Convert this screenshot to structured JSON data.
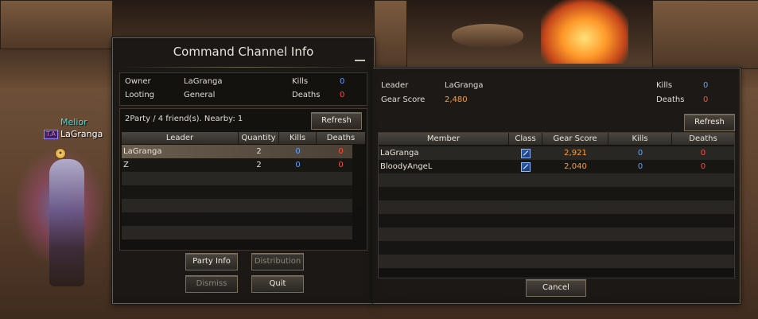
{
  "character": {
    "title": "Melior",
    "tag": "T.A",
    "name": "LaGranga"
  },
  "cc": {
    "title": "Command Channel Info",
    "owner_label": "Owner",
    "owner_value": "LaGranga",
    "looting_label": "Looting",
    "looting_value": "General",
    "kills_label": "Kills",
    "kills_value": "0",
    "deaths_label": "Deaths",
    "deaths_value": "0",
    "party_summary": "2Party / 4 friend(s). Nearby: 1",
    "refresh_label": "Refresh",
    "columns": [
      "Leader",
      "Quantity",
      "Kills",
      "Deaths"
    ],
    "rows": [
      {
        "leader": "LaGranga",
        "quantity": "2",
        "kills": "0",
        "deaths": "0"
      },
      {
        "leader": "Z",
        "quantity": "2",
        "kills": "0",
        "deaths": "0"
      }
    ],
    "buttons": {
      "party_info": "Party Info",
      "distribution": "Distribution",
      "dismiss": "Dismiss",
      "quit": "Quit"
    }
  },
  "party": {
    "leader_label": "Leader",
    "leader_value": "LaGranga",
    "gear_label": "Gear Score",
    "gear_value": "2,480",
    "kills_label": "Kills",
    "kills_value": "0",
    "deaths_label": "Deaths",
    "deaths_value": "0",
    "refresh_label": "Refresh",
    "columns": [
      "Member",
      "Class",
      "Gear Score",
      "Kills",
      "Deaths"
    ],
    "members": [
      {
        "member": "LaGranga",
        "class_icon": "blade-class-icon",
        "gear_score": "2,921",
        "kills": "0",
        "deaths": "0"
      },
      {
        "member": "BloodyAngeL",
        "class_icon": "blade-class-icon",
        "gear_score": "2,040",
        "kills": "0",
        "deaths": "0"
      }
    ],
    "cancel_label": "Cancel"
  },
  "colors": {
    "kills": "#5ea0ff",
    "deaths": "#ff4b3a",
    "gear_score": "#ff9c33",
    "panel_bg": "#181614"
  }
}
